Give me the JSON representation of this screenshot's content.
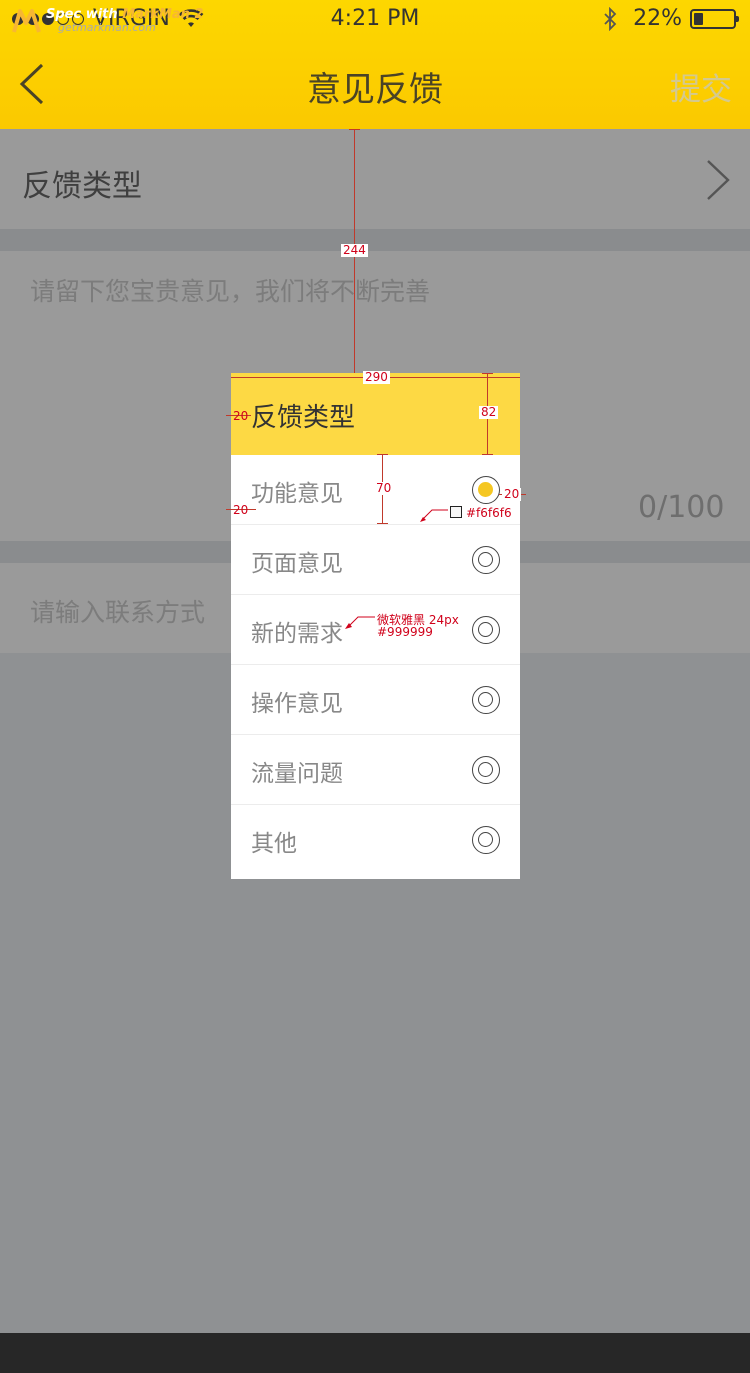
{
  "status_bar": {
    "carrier": "VIRGIN",
    "time": "4:21 PM",
    "battery": "22%",
    "battery_level": 0.22
  },
  "nav": {
    "title": "意见反馈",
    "submit_label": "提交"
  },
  "form": {
    "type_label": "反馈类型",
    "feedback_placeholder": "请留下您宝贵意见，我们将不断完善",
    "counter": "0/100",
    "contact_placeholder": "请输入联系方式"
  },
  "popup": {
    "title": "反馈类型",
    "options": [
      {
        "label": "功能意见",
        "selected": true
      },
      {
        "label": "页面意见",
        "selected": false
      },
      {
        "label": "新的需求",
        "selected": false
      },
      {
        "label": "操作意见",
        "selected": false
      },
      {
        "label": "流量问题",
        "selected": false
      },
      {
        "label": "其他",
        "selected": false
      }
    ]
  },
  "annotations": {
    "top_offset": "244",
    "popup_width": "290",
    "header_height": "82",
    "option_height": "70",
    "padding_left_header": "20",
    "padding_left_option": "20",
    "padding_right": "20",
    "divider_color": "#f6f6f6",
    "font_note_1": "微软雅黑 24px",
    "font_note_2": "#999999"
  },
  "footer": {
    "brand_prefix": "Spec with ",
    "brand_name": "MarkMan 2",
    "url": "getmarkman.com"
  },
  "colors": {
    "accent": "#fdd944",
    "radio_selected": "#f5c722",
    "overlay": "#8f9193"
  }
}
